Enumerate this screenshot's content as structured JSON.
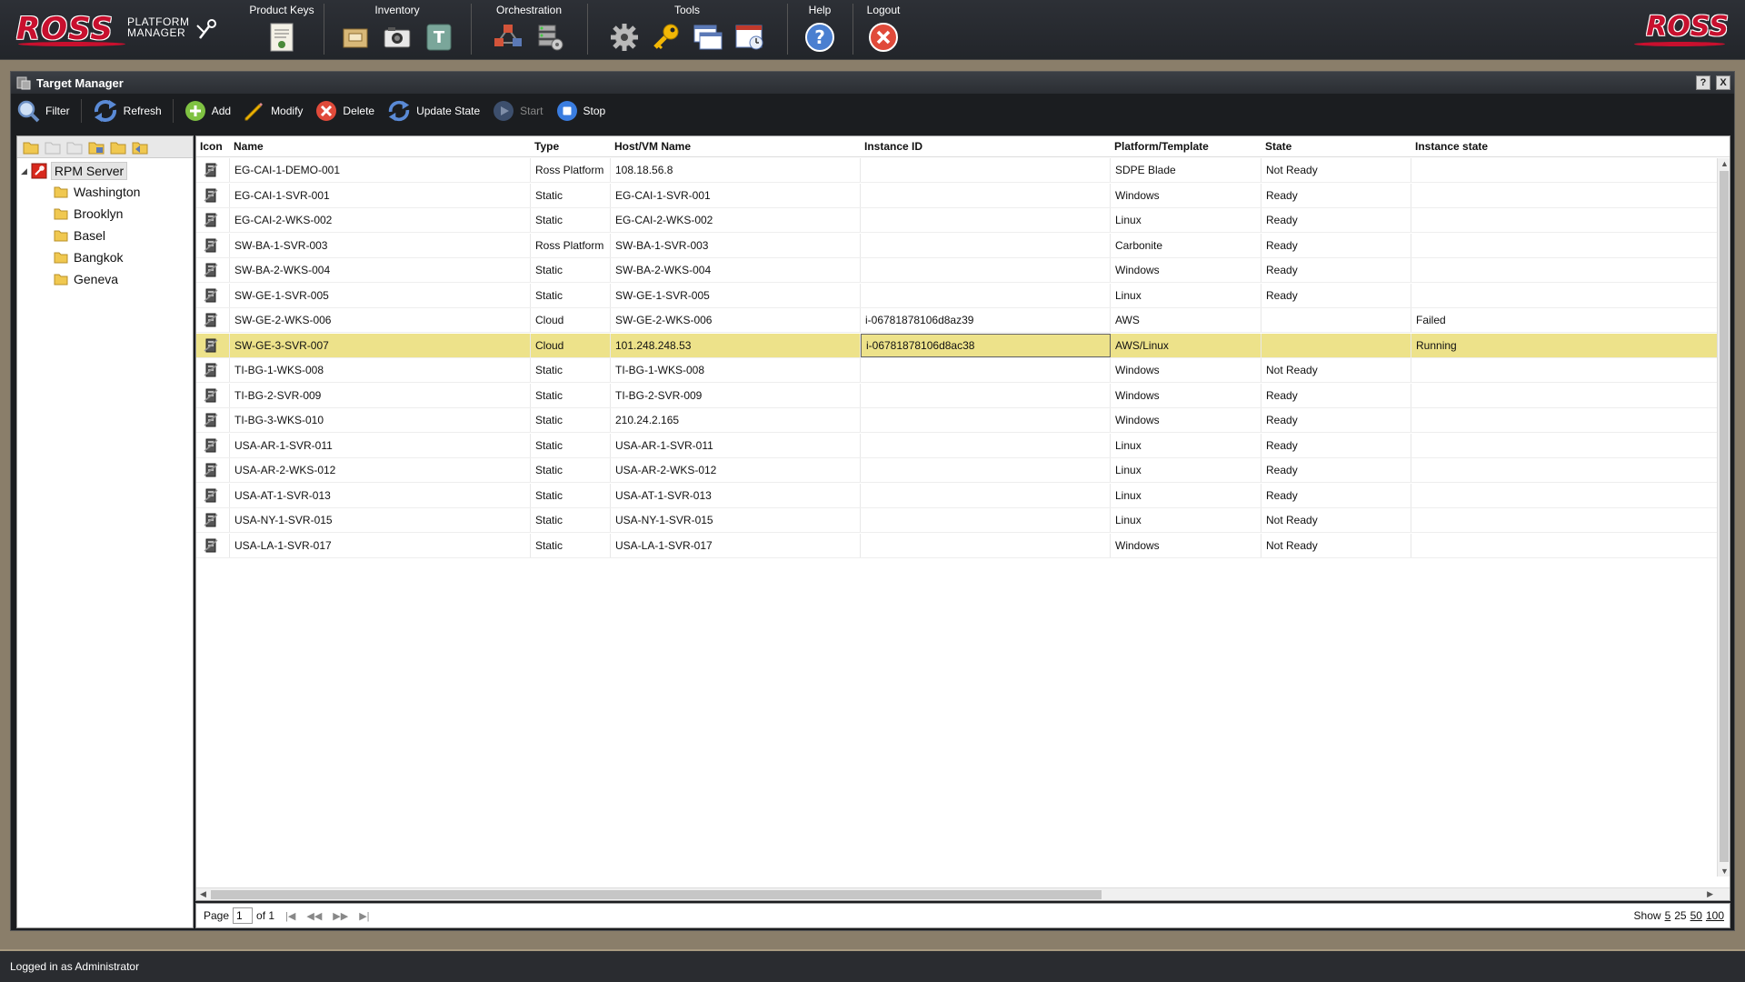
{
  "brand": {
    "logo_text": "ROSS",
    "product_line1": "PLATFORM",
    "product_line2": "MANAGER",
    "accent_color": "#c8102e"
  },
  "nav": {
    "product_keys": {
      "label": "Product Keys",
      "icons": [
        "certificate-icon"
      ]
    },
    "inventory": {
      "label": "Inventory",
      "icons": [
        "package-icon",
        "camera-icon",
        "template-icon"
      ]
    },
    "orchestration": {
      "label": "Orchestration",
      "icons": [
        "cubes-network-icon",
        "server-config-icon"
      ]
    },
    "tools": {
      "label": "Tools",
      "icons": [
        "gear-icon",
        "key-icon",
        "windows-icon",
        "scheduler-icon"
      ]
    },
    "help": {
      "label": "Help",
      "icons": [
        "help-icon"
      ]
    },
    "logout": {
      "label": "Logout",
      "icons": [
        "logout-icon"
      ]
    }
  },
  "window": {
    "title": "Target Manager",
    "help_btn": "?",
    "close_btn": "X"
  },
  "toolbar": {
    "filter": "Filter",
    "refresh": "Refresh",
    "add": "Add",
    "modify": "Modify",
    "delete": "Delete",
    "update_state": "Update State",
    "start": "Start",
    "stop": "Stop"
  },
  "tree": {
    "root": "RPM Server",
    "children": [
      "Washington",
      "Brooklyn",
      "Basel",
      "Bangkok",
      "Geneva"
    ]
  },
  "grid": {
    "columns": [
      "Icon",
      "Name",
      "Type",
      "Host/VM Name",
      "Instance ID",
      "Platform/Template",
      "State",
      "Instance state"
    ],
    "rows": [
      {
        "name": "EG-CAI-1-DEMO-001",
        "type": "Ross Platform",
        "host": "108.18.56.8",
        "instance_id": "",
        "platform": "SDPE Blade",
        "state": "Not Ready",
        "instance_state": ""
      },
      {
        "name": "EG-CAI-1-SVR-001",
        "type": "Static",
        "host": "EG-CAI-1-SVR-001",
        "instance_id": "",
        "platform": "Windows",
        "state": "Ready",
        "instance_state": ""
      },
      {
        "name": "EG-CAI-2-WKS-002",
        "type": "Static",
        "host": "EG-CAI-2-WKS-002",
        "instance_id": "",
        "platform": "Linux",
        "state": "Ready",
        "instance_state": ""
      },
      {
        "name": "SW-BA-1-SVR-003",
        "type": "Ross Platform",
        "host": "SW-BA-1-SVR-003",
        "instance_id": "",
        "platform": "Carbonite",
        "state": "Ready",
        "instance_state": ""
      },
      {
        "name": "SW-BA-2-WKS-004",
        "type": "Static",
        "host": "SW-BA-2-WKS-004",
        "instance_id": "",
        "platform": "Windows",
        "state": "Ready",
        "instance_state": ""
      },
      {
        "name": "SW-GE-1-SVR-005",
        "type": "Static",
        "host": "SW-GE-1-SVR-005",
        "instance_id": "",
        "platform": "Linux",
        "state": "Ready",
        "instance_state": ""
      },
      {
        "name": "SW-GE-2-WKS-006",
        "type": "Cloud",
        "host": "SW-GE-2-WKS-006",
        "instance_id": "i-06781878106d8az39",
        "platform": "AWS",
        "state": "",
        "instance_state": "Failed"
      },
      {
        "name": "SW-GE-3-SVR-007",
        "type": "Cloud",
        "host": "101.248.248.53",
        "instance_id": "i-06781878106d8ac38",
        "platform": "AWS/Linux",
        "state": "",
        "instance_state": "Running",
        "selected": true
      },
      {
        "name": "TI-BG-1-WKS-008",
        "type": "Static",
        "host": "TI-BG-1-WKS-008",
        "instance_id": "",
        "platform": "Windows",
        "state": "Not Ready",
        "instance_state": ""
      },
      {
        "name": "TI-BG-2-SVR-009",
        "type": "Static",
        "host": "TI-BG-2-SVR-009",
        "instance_id": "",
        "platform": "Windows",
        "state": "Ready",
        "instance_state": ""
      },
      {
        "name": "TI-BG-3-WKS-010",
        "type": "Static",
        "host": "210.24.2.165",
        "instance_id": "",
        "platform": "Windows",
        "state": "Ready",
        "instance_state": ""
      },
      {
        "name": "USA-AR-1-SVR-011",
        "type": "Static",
        "host": "USA-AR-1-SVR-011",
        "instance_id": "",
        "platform": "Linux",
        "state": "Ready",
        "instance_state": ""
      },
      {
        "name": "USA-AR-2-WKS-012",
        "type": "Static",
        "host": "USA-AR-2-WKS-012",
        "instance_id": "",
        "platform": "Linux",
        "state": "Ready",
        "instance_state": ""
      },
      {
        "name": "USA-AT-1-SVR-013",
        "type": "Static",
        "host": "USA-AT-1-SVR-013",
        "instance_id": "",
        "platform": "Linux",
        "state": "Ready",
        "instance_state": ""
      },
      {
        "name": "USA-NY-1-SVR-015",
        "type": "Static",
        "host": "USA-NY-1-SVR-015",
        "instance_id": "",
        "platform": "Linux",
        "state": "Not Ready",
        "instance_state": ""
      },
      {
        "name": "USA-LA-1-SVR-017",
        "type": "Static",
        "host": "USA-LA-1-SVR-017",
        "instance_id": "",
        "platform": "Windows",
        "state": "Not Ready",
        "instance_state": ""
      }
    ]
  },
  "pager": {
    "page_label": "Page",
    "page_value": "1",
    "of_label": "of 1",
    "first": "|◀",
    "prev": "◀◀",
    "next": "▶▶",
    "last": "▶|",
    "show_label": "Show",
    "sizes": [
      "5",
      "25",
      "50",
      "100"
    ]
  },
  "status": {
    "logged_in": "Logged in as Administrator"
  }
}
